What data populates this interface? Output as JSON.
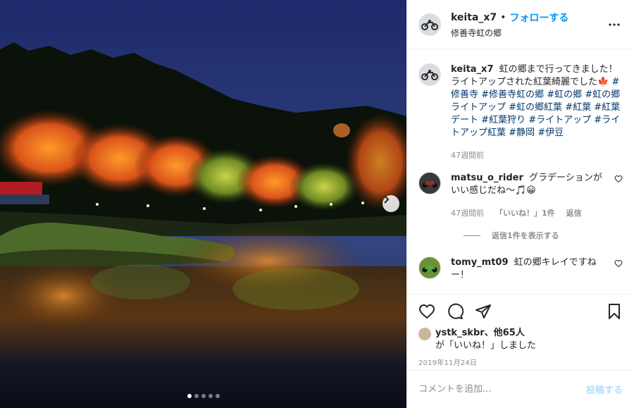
{
  "author": {
    "username": "keita_x7",
    "separator": "•",
    "follow_label": "フォローする",
    "location": "修善寺虹の郷"
  },
  "carousel": {
    "slides": 5,
    "active": 0
  },
  "caption": {
    "username": "keita_x7",
    "text": "虹の郷まで行ってきました！ライトアップされた紅葉綺麗でした🍁",
    "hashtags": [
      "#修善寺",
      "#修善寺虹の郷",
      "#虹の郷",
      "#虹の郷ライトアップ",
      "#虹の郷紅葉",
      "#紅葉",
      "#紅葉デート",
      "#紅葉狩り",
      "#ライトアップ",
      "#ライトアップ紅葉",
      "#静岡",
      "#伊豆"
    ],
    "time": "47週間前"
  },
  "comments": [
    {
      "username": "matsu_o_rider",
      "text": "グラデーションがいい感じだね〜🎵😀",
      "time": "47週間前",
      "likes": "「いいね！」1件",
      "reply": "返信",
      "view_replies": "返信1件を表示する"
    },
    {
      "username": "tomy_mt09",
      "text": "虹の郷キレイですねー！"
    }
  ],
  "likes_line": {
    "user": "ystk_skbr",
    "others": "、他65人",
    "suffix": "が「いいね！」しました"
  },
  "date": "2019年11月24日",
  "comment_box": {
    "placeholder": "コメントを追加...",
    "post_label": "投稿する"
  },
  "colors": {
    "accent": "#0095f6",
    "hashtag": "#00376b",
    "muted": "#8e8e8e"
  }
}
